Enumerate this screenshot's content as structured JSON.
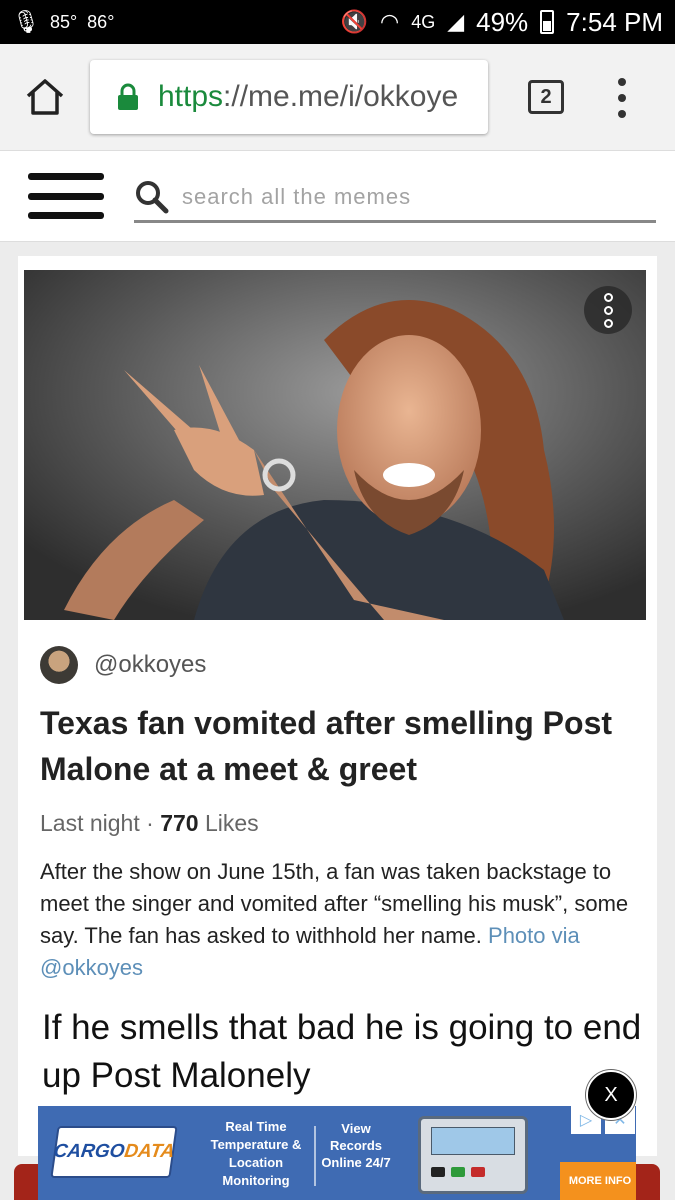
{
  "status_bar": {
    "temp_current": "85°",
    "temp_high": "86°",
    "network": "4G",
    "battery": "49%",
    "time": "7:54 PM"
  },
  "browser": {
    "url_scheme": "https",
    "url_rest": "://me.me/i/okkoye",
    "tab_count": "2"
  },
  "site": {
    "search_placeholder": "search all the memes"
  },
  "post": {
    "author": "@okkoyes",
    "headline": "Texas fan vomited after smelling Post Malone at a meet & greet",
    "time": "Last night",
    "separator": "·",
    "likes_count": "770",
    "likes_label": "Likes",
    "description": "After the show on June 15th, a fan was taken backstage to meet the singer and vomited after “smelling his musk”, some say. The fan has asked to withhold her name.",
    "photo_credit": "Photo via @okkoyes",
    "caption": "If he smells that bad he is going to end up Post Malonely"
  },
  "ad": {
    "logo_word1": "CARGO",
    "logo_word2": "DATA",
    "text1": "Real Time Temperature & Location Monitoring",
    "text2": "View Records Online 24/7",
    "more_info": "MORE INFO",
    "close_label": "X"
  },
  "colors": {
    "secure_green": "#1a8a3c",
    "link_blue": "#5d8fb8",
    "ad_blue": "#3f6bb3",
    "ad_orange": "#f4911d"
  }
}
